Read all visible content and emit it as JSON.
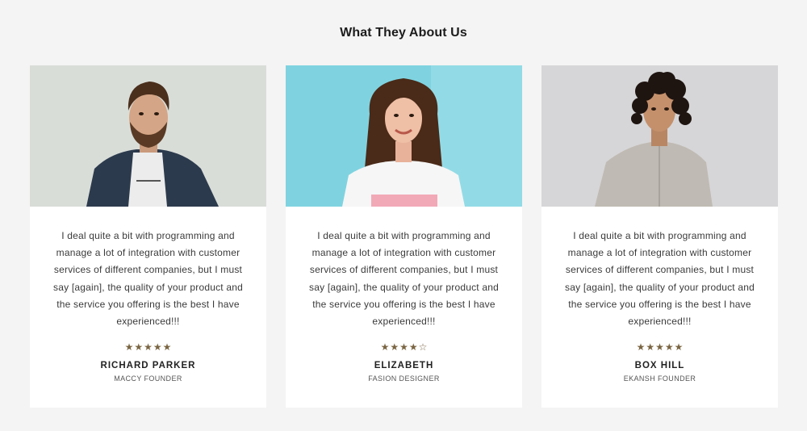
{
  "section": {
    "title": "What They About Us"
  },
  "testimonials": [
    {
      "quote": "I deal quite a bit with programming and manage a lot of integration with customer services of different companies, but I must say [again], the quality of your product and the service you offering is the best I have experienced!!!",
      "rating": 5,
      "rating_max": 5,
      "name": "RICHARD PARKER",
      "role": "MACCY FOUNDER",
      "photo_bg": "#d9ddd8"
    },
    {
      "quote": "I deal quite a bit with programming and manage a lot of integration with customer services of different companies, but I must say [again], the quality of your product and the service you offering is the best I have experienced!!!",
      "rating": 4,
      "rating_max": 5,
      "name": "ELIZABETH",
      "role": "FASION DESIGNER",
      "photo_bg": "#7fd3e0"
    },
    {
      "quote": "I deal quite a bit with programming and manage a lot of integration with customer services of different companies, but I must say [again], the quality of your product and the service you offering is the best I have experienced!!!",
      "rating": 5,
      "rating_max": 5,
      "name": "BOX HILL",
      "role": "EKANSH FOUNDER",
      "photo_bg": "#d6d6d8"
    }
  ],
  "colors": {
    "page_bg": "#f4f4f4",
    "card_bg": "#ffffff",
    "star": "#7a6542"
  }
}
